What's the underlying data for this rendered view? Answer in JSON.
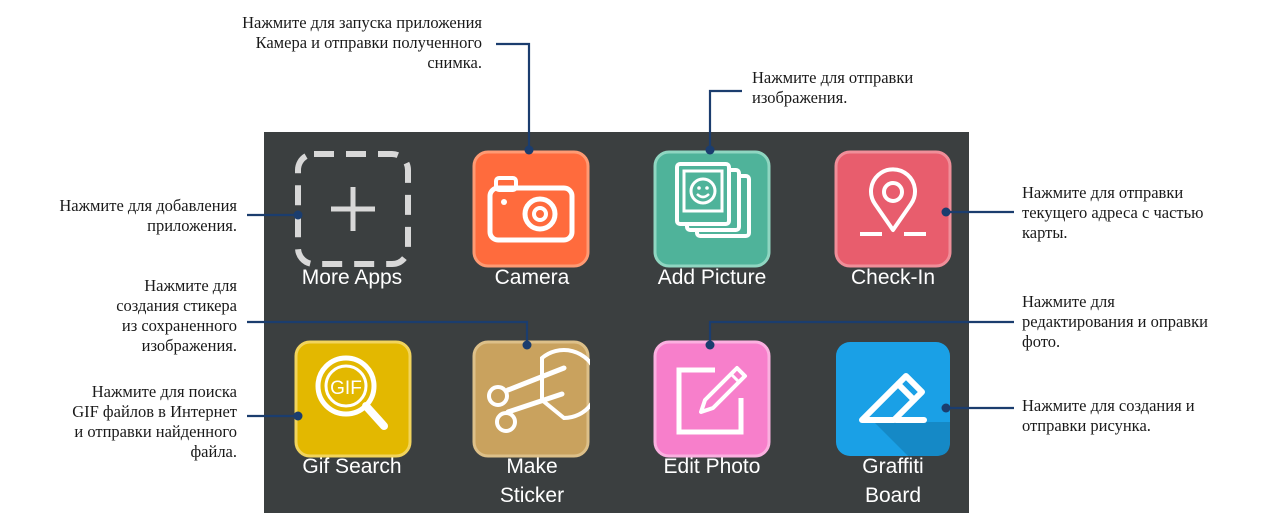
{
  "apps": [
    {
      "label": "More Apps",
      "icon": "plus-icon"
    },
    {
      "label": "Camera",
      "icon": "camera-icon",
      "color": "#ff6b3d"
    },
    {
      "label": "Add Picture",
      "icon": "picture-icon",
      "color": "#4fb39a"
    },
    {
      "label": "Check-In",
      "icon": "location-pin-icon",
      "color": "#e85d6d"
    },
    {
      "label": "Gif Search",
      "icon": "gif-search-icon",
      "color": "#e3b800"
    },
    {
      "label": "Make\nSticker",
      "icon": "scissors-icon",
      "color": "#c9a25e"
    },
    {
      "label": "Edit Photo",
      "icon": "pencil-icon",
      "color": "#f77fcb"
    },
    {
      "label": "Graffiti\nBoard",
      "icon": "eraser-icon",
      "color": "#1aa0e6"
    }
  ],
  "callouts": {
    "camera": "Нажмите для запуска приложения\nКамера и отправки полученного\nснимка.",
    "add_picture": "Нажмите для отправки\nизображения.",
    "more_apps": "Нажмите для добавления\nприложения.",
    "check_in": "Нажмите для отправки\nтекущего адреса с частью\nкарты.",
    "make_sticker": "Нажмите для\nсоздания стикера\nиз сохраненного\nизображения.",
    "edit_photo": "Нажмите для\nредактирования и оправки\nфото.",
    "gif_search": "Нажмите для поиска\nGIF файлов в Интернет\nи отправки найденного\nфайла.",
    "graffiti": "Нажмите для создания и\nотправки рисунка."
  },
  "colors": {
    "panel": "#3b3f40",
    "line": "#1b3d6e"
  }
}
